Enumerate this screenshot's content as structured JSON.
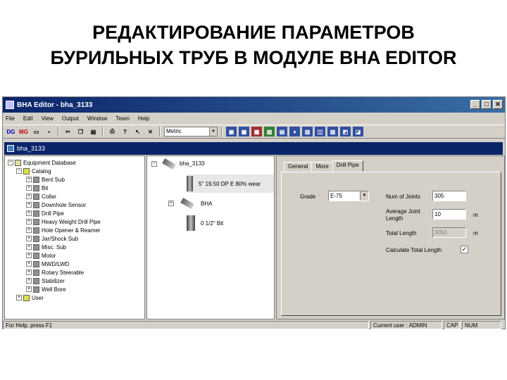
{
  "slide": {
    "title_line1": "РЕДАКТИРОВАНИЕ ПАРАМЕТРОВ",
    "title_line2": "БУРИЛЬНЫХ ТРУБ В МОДУЛЕ BHA EDITOR"
  },
  "window": {
    "title": "BHA Editor - bha_3133",
    "caption_buttons": [
      "_",
      "□",
      "✕"
    ]
  },
  "menu": [
    "File",
    "Edit",
    "View",
    "Output",
    "Window",
    "Team",
    "Help"
  ],
  "toolbar": {
    "left_buttons": [
      "DG",
      "MG"
    ],
    "units_combo": "Metric"
  },
  "document": {
    "title": "bha_3133"
  },
  "tree": {
    "root": "Equipment Database",
    "catalog": "Catalog",
    "items": [
      "Bent Sub",
      "Bit",
      "Collar",
      "Downhole Sensor",
      "Drill Pipe",
      "Heavy Weight Drill Pipe",
      "Hole Opener & Reamer",
      "Jar/Shock Sub",
      "Misc. Sub",
      "Motor",
      "MWD/LWD",
      "Rotary Steerable",
      "Stabilizer",
      "Well Bore"
    ],
    "user": "User"
  },
  "bha": {
    "root": "bha_3133",
    "items": [
      "5\" 19.50 DP E 80% wear",
      "BHA",
      "0 1/2\" Bit"
    ]
  },
  "tabs": [
    "General",
    "More",
    "Drill Pipe"
  ],
  "form": {
    "grade_label": "Grade",
    "grade_value": "E-75",
    "num_joints_label": "Num of Joints",
    "num_joints_value": "305",
    "avg_joint_label_1": "Average Joint",
    "avg_joint_label_2": "Length",
    "avg_joint_value": "10",
    "avg_joint_unit": "m",
    "total_length_label": "Total Length",
    "total_length_value": "3050",
    "total_length_unit": "m",
    "calc_label": "Calculate Total Length",
    "calc_checked": "✓"
  },
  "status": {
    "help": "For Help, press F1",
    "user": "Current user : ADMIN",
    "cap": "CAP",
    "num": "NUM"
  }
}
